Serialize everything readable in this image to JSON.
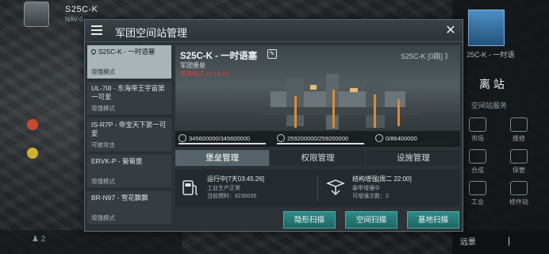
{
  "background": {
    "player_name": "S25C-K",
    "player_sub": "NAV-0",
    "bottom_left": "♟ 2"
  },
  "right_panel": {
    "portrait_label": "25C-K - 一时语",
    "leave_label": "离 站",
    "service_label": "空间站服务",
    "grid": [
      "市场",
      "维修",
      "合成",
      "保管",
      "工业",
      "修件站"
    ],
    "bottom_left": "远景",
    "bottom_sep": "|"
  },
  "dialog": {
    "title": "军团空间站管理",
    "close": "✕"
  },
  "stations": [
    {
      "name": "S25C-K - 一时语塞",
      "status": "增强模式",
      "active": true
    },
    {
      "name": "UL-7I8 - 东海帝王宇宙第一可爱",
      "status": "增强模式",
      "active": false
    },
    {
      "name": "IS-R7P - 帝宝天下第一可爱",
      "status": "可被攻击",
      "active": false
    },
    {
      "name": "ERVK-P - 菊菊堡",
      "status": "增强模式",
      "active": false
    },
    {
      "name": "BR-N97 - 雪花飘飘",
      "status": "增强模式",
      "active": false
    }
  ],
  "hero": {
    "name": "S25C-K - 一时语塞",
    "type": "军团堡垒",
    "mode": "增强模式 23:19:24",
    "right_label": "S25C-K [0跳] 》",
    "stats": [
      {
        "label": "345600000/345600000",
        "fill": 1.0
      },
      {
        "label": "259200000/259200000",
        "fill": 1.0
      },
      {
        "label": "0/86400000",
        "fill": 0.0
      }
    ]
  },
  "tabs": [
    {
      "label": "堡垒管理",
      "active": true
    },
    {
      "label": "权限管理",
      "active": false
    },
    {
      "label": "设施管理",
      "active": false
    }
  ],
  "info": {
    "left": {
      "title": "运行中[7天03:45:26]",
      "lines": [
        "工业生产正常",
        "当前燃料：8230035"
      ]
    },
    "right": {
      "title": "结构增强[周二 22:00]",
      "lines": [
        "装甲增强中",
        "可增强次数：2"
      ]
    }
  },
  "actions": [
    "隐形扫描",
    "空间扫描",
    "基地扫描"
  ]
}
